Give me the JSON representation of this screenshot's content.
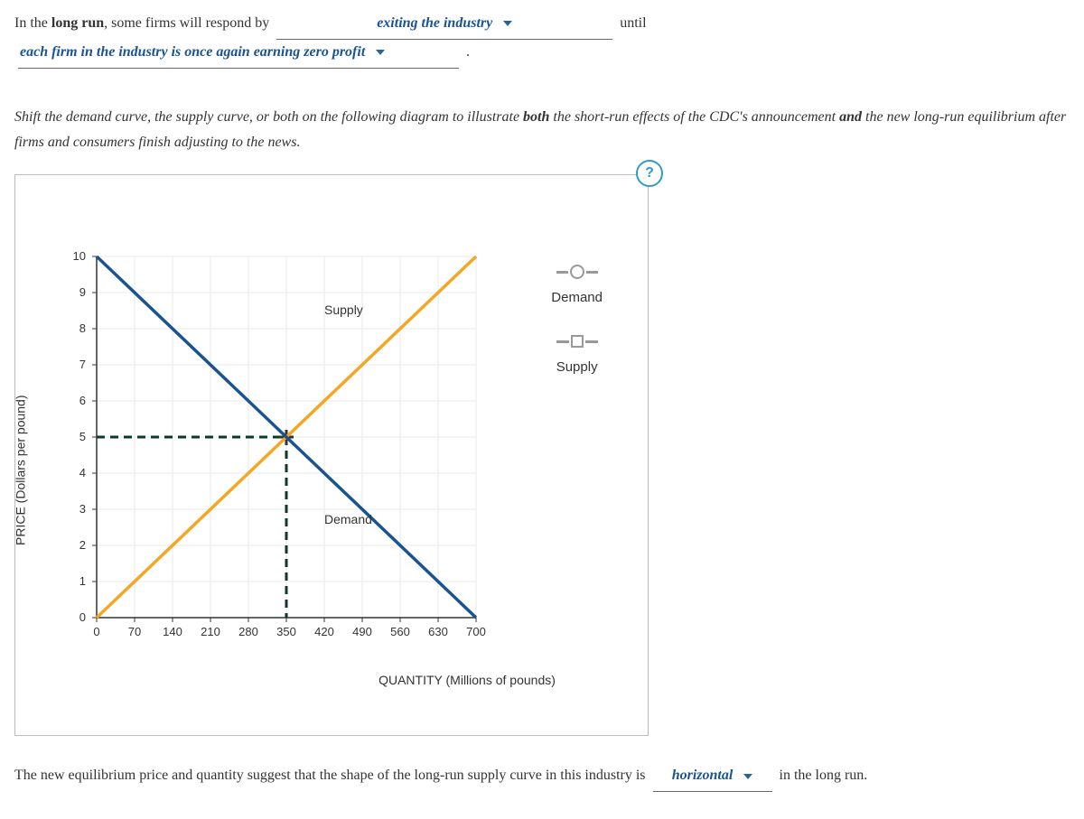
{
  "sentence1": {
    "prefix": "In the ",
    "bold1": "long run",
    "mid1": ", some firms will respond by ",
    "dropdown1": "exiting the industry",
    "mid2": " until ",
    "dropdown2": "each firm in the industry is once again earning zero profit",
    "suffix": " ."
  },
  "instruction": {
    "pre": "Shift the demand curve, the supply curve, or both on the following diagram to illustrate ",
    "bold1": "both",
    "mid1": " the short-run effects of the CDC's announcement ",
    "bold2": "and",
    "mid2": " the new long-run equilibrium after firms and consumers finish adjusting to the news."
  },
  "help": "?",
  "legend": {
    "demand": "Demand",
    "supply": "Supply"
  },
  "sentence2": {
    "prefix": "The new equilibrium price and quantity suggest that the shape of the long-run supply curve in this industry is ",
    "dropdown": "horizontal",
    "suffix": " in the long run."
  },
  "chart_data": {
    "type": "line",
    "title": "",
    "xlabel": "QUANTITY (Millions of pounds)",
    "ylabel": "PRICE (Dollars per pound)",
    "xticks": [
      0,
      70,
      140,
      210,
      280,
      350,
      420,
      490,
      560,
      630,
      700
    ],
    "yticks": [
      0,
      1,
      2,
      3,
      4,
      5,
      6,
      7,
      8,
      9,
      10
    ],
    "xlim": [
      0,
      700
    ],
    "ylim": [
      0,
      10
    ],
    "series": [
      {
        "name": "Supply",
        "color": "#f5a623",
        "points": [
          [
            0,
            0
          ],
          [
            700,
            10
          ]
        ]
      },
      {
        "name": "Demand",
        "color": "#1a5490",
        "points": [
          [
            0,
            10
          ],
          [
            700,
            0
          ]
        ]
      }
    ],
    "intersection": {
      "x": 350,
      "y": 5
    },
    "series_labels": [
      {
        "name": "Supply",
        "x": 420,
        "y": 8.4
      },
      {
        "name": "Demand",
        "x": 420,
        "y": 2.6
      }
    ]
  }
}
